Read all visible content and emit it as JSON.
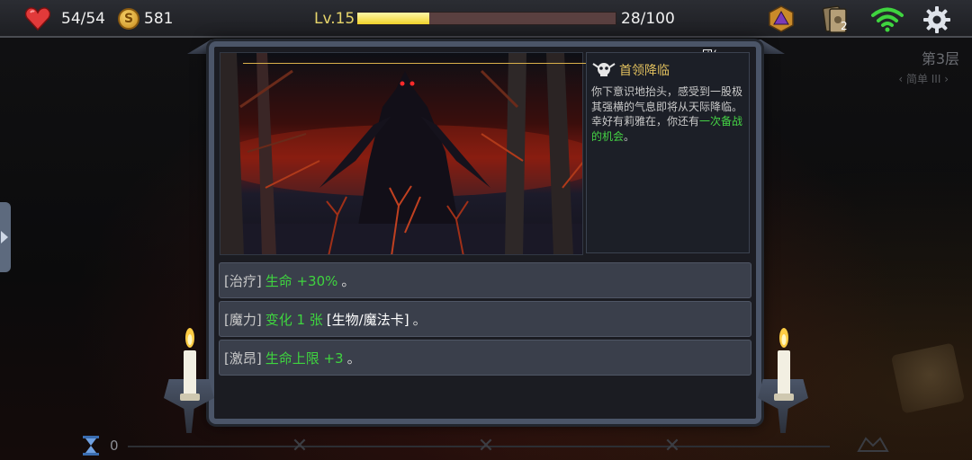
{
  "hud": {
    "hp": "54/54",
    "gold": "581",
    "coin_symbol": "S",
    "level": "Lv.15",
    "xp_text": "28/100",
    "xp_fraction": 0.28,
    "deck_count": "2",
    "icons": [
      "heart-icon",
      "coin-icon",
      "d20-icon",
      "card-deck-icon",
      "wifi-icon",
      "gear-icon"
    ]
  },
  "floor": {
    "label": "第3层",
    "difficulty": "‹ 简单 III ›"
  },
  "event": {
    "top_mark": "一团(",
    "title": "首领降临",
    "body_plain": "你下意识地抬头，感受到一股极其强横的气息即将从天际降临。",
    "body_plain2": "幸好有莉雅在，你还有",
    "body_green": "一次备战的机会",
    "body_end": "。"
  },
  "options": [
    {
      "tag": "[治疗]",
      "effect": "生命 +30%",
      "extra": "",
      "end": "。"
    },
    {
      "tag": "[魔力]",
      "effect": "变化 1 张",
      "extra": "[生物/魔法卡]",
      "end": "。"
    },
    {
      "tag": "[激昂]",
      "effect": "生命上限 +3",
      "extra": "",
      "end": "。"
    }
  ],
  "bottom": {
    "count": "0"
  },
  "colors": {
    "accent_gold": "#e0bf5e",
    "effect_green": "#3fd43f",
    "xp_yellow": "#f1d32c",
    "hp_red": "#e23a3a"
  }
}
